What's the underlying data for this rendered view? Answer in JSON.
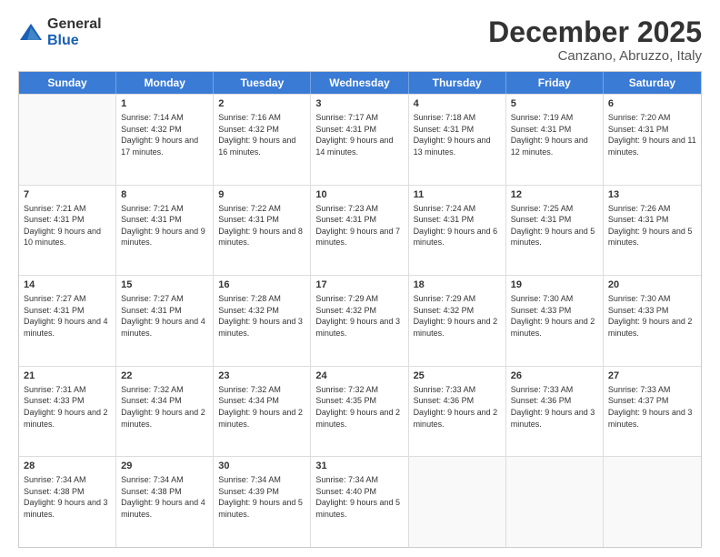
{
  "logo": {
    "general": "General",
    "blue": "Blue"
  },
  "title": "December 2025",
  "location": "Canzano, Abruzzo, Italy",
  "days_of_week": [
    "Sunday",
    "Monday",
    "Tuesday",
    "Wednesday",
    "Thursday",
    "Friday",
    "Saturday"
  ],
  "weeks": [
    [
      {
        "day": "",
        "sunrise": "",
        "sunset": "",
        "daylight": ""
      },
      {
        "day": "1",
        "sunrise": "Sunrise: 7:14 AM",
        "sunset": "Sunset: 4:32 PM",
        "daylight": "Daylight: 9 hours and 17 minutes."
      },
      {
        "day": "2",
        "sunrise": "Sunrise: 7:16 AM",
        "sunset": "Sunset: 4:32 PM",
        "daylight": "Daylight: 9 hours and 16 minutes."
      },
      {
        "day": "3",
        "sunrise": "Sunrise: 7:17 AM",
        "sunset": "Sunset: 4:31 PM",
        "daylight": "Daylight: 9 hours and 14 minutes."
      },
      {
        "day": "4",
        "sunrise": "Sunrise: 7:18 AM",
        "sunset": "Sunset: 4:31 PM",
        "daylight": "Daylight: 9 hours and 13 minutes."
      },
      {
        "day": "5",
        "sunrise": "Sunrise: 7:19 AM",
        "sunset": "Sunset: 4:31 PM",
        "daylight": "Daylight: 9 hours and 12 minutes."
      },
      {
        "day": "6",
        "sunrise": "Sunrise: 7:20 AM",
        "sunset": "Sunset: 4:31 PM",
        "daylight": "Daylight: 9 hours and 11 minutes."
      }
    ],
    [
      {
        "day": "7",
        "sunrise": "Sunrise: 7:21 AM",
        "sunset": "Sunset: 4:31 PM",
        "daylight": "Daylight: 9 hours and 10 minutes."
      },
      {
        "day": "8",
        "sunrise": "Sunrise: 7:21 AM",
        "sunset": "Sunset: 4:31 PM",
        "daylight": "Daylight: 9 hours and 9 minutes."
      },
      {
        "day": "9",
        "sunrise": "Sunrise: 7:22 AM",
        "sunset": "Sunset: 4:31 PM",
        "daylight": "Daylight: 9 hours and 8 minutes."
      },
      {
        "day": "10",
        "sunrise": "Sunrise: 7:23 AM",
        "sunset": "Sunset: 4:31 PM",
        "daylight": "Daylight: 9 hours and 7 minutes."
      },
      {
        "day": "11",
        "sunrise": "Sunrise: 7:24 AM",
        "sunset": "Sunset: 4:31 PM",
        "daylight": "Daylight: 9 hours and 6 minutes."
      },
      {
        "day": "12",
        "sunrise": "Sunrise: 7:25 AM",
        "sunset": "Sunset: 4:31 PM",
        "daylight": "Daylight: 9 hours and 5 minutes."
      },
      {
        "day": "13",
        "sunrise": "Sunrise: 7:26 AM",
        "sunset": "Sunset: 4:31 PM",
        "daylight": "Daylight: 9 hours and 5 minutes."
      }
    ],
    [
      {
        "day": "14",
        "sunrise": "Sunrise: 7:27 AM",
        "sunset": "Sunset: 4:31 PM",
        "daylight": "Daylight: 9 hours and 4 minutes."
      },
      {
        "day": "15",
        "sunrise": "Sunrise: 7:27 AM",
        "sunset": "Sunset: 4:31 PM",
        "daylight": "Daylight: 9 hours and 4 minutes."
      },
      {
        "day": "16",
        "sunrise": "Sunrise: 7:28 AM",
        "sunset": "Sunset: 4:32 PM",
        "daylight": "Daylight: 9 hours and 3 minutes."
      },
      {
        "day": "17",
        "sunrise": "Sunrise: 7:29 AM",
        "sunset": "Sunset: 4:32 PM",
        "daylight": "Daylight: 9 hours and 3 minutes."
      },
      {
        "day": "18",
        "sunrise": "Sunrise: 7:29 AM",
        "sunset": "Sunset: 4:32 PM",
        "daylight": "Daylight: 9 hours and 2 minutes."
      },
      {
        "day": "19",
        "sunrise": "Sunrise: 7:30 AM",
        "sunset": "Sunset: 4:33 PM",
        "daylight": "Daylight: 9 hours and 2 minutes."
      },
      {
        "day": "20",
        "sunrise": "Sunrise: 7:30 AM",
        "sunset": "Sunset: 4:33 PM",
        "daylight": "Daylight: 9 hours and 2 minutes."
      }
    ],
    [
      {
        "day": "21",
        "sunrise": "Sunrise: 7:31 AM",
        "sunset": "Sunset: 4:33 PM",
        "daylight": "Daylight: 9 hours and 2 minutes."
      },
      {
        "day": "22",
        "sunrise": "Sunrise: 7:32 AM",
        "sunset": "Sunset: 4:34 PM",
        "daylight": "Daylight: 9 hours and 2 minutes."
      },
      {
        "day": "23",
        "sunrise": "Sunrise: 7:32 AM",
        "sunset": "Sunset: 4:34 PM",
        "daylight": "Daylight: 9 hours and 2 minutes."
      },
      {
        "day": "24",
        "sunrise": "Sunrise: 7:32 AM",
        "sunset": "Sunset: 4:35 PM",
        "daylight": "Daylight: 9 hours and 2 minutes."
      },
      {
        "day": "25",
        "sunrise": "Sunrise: 7:33 AM",
        "sunset": "Sunset: 4:36 PM",
        "daylight": "Daylight: 9 hours and 2 minutes."
      },
      {
        "day": "26",
        "sunrise": "Sunrise: 7:33 AM",
        "sunset": "Sunset: 4:36 PM",
        "daylight": "Daylight: 9 hours and 3 minutes."
      },
      {
        "day": "27",
        "sunrise": "Sunrise: 7:33 AM",
        "sunset": "Sunset: 4:37 PM",
        "daylight": "Daylight: 9 hours and 3 minutes."
      }
    ],
    [
      {
        "day": "28",
        "sunrise": "Sunrise: 7:34 AM",
        "sunset": "Sunset: 4:38 PM",
        "daylight": "Daylight: 9 hours and 3 minutes."
      },
      {
        "day": "29",
        "sunrise": "Sunrise: 7:34 AM",
        "sunset": "Sunset: 4:38 PM",
        "daylight": "Daylight: 9 hours and 4 minutes."
      },
      {
        "day": "30",
        "sunrise": "Sunrise: 7:34 AM",
        "sunset": "Sunset: 4:39 PM",
        "daylight": "Daylight: 9 hours and 5 minutes."
      },
      {
        "day": "31",
        "sunrise": "Sunrise: 7:34 AM",
        "sunset": "Sunset: 4:40 PM",
        "daylight": "Daylight: 9 hours and 5 minutes."
      },
      {
        "day": "",
        "sunrise": "",
        "sunset": "",
        "daylight": ""
      },
      {
        "day": "",
        "sunrise": "",
        "sunset": "",
        "daylight": ""
      },
      {
        "day": "",
        "sunrise": "",
        "sunset": "",
        "daylight": ""
      }
    ]
  ]
}
